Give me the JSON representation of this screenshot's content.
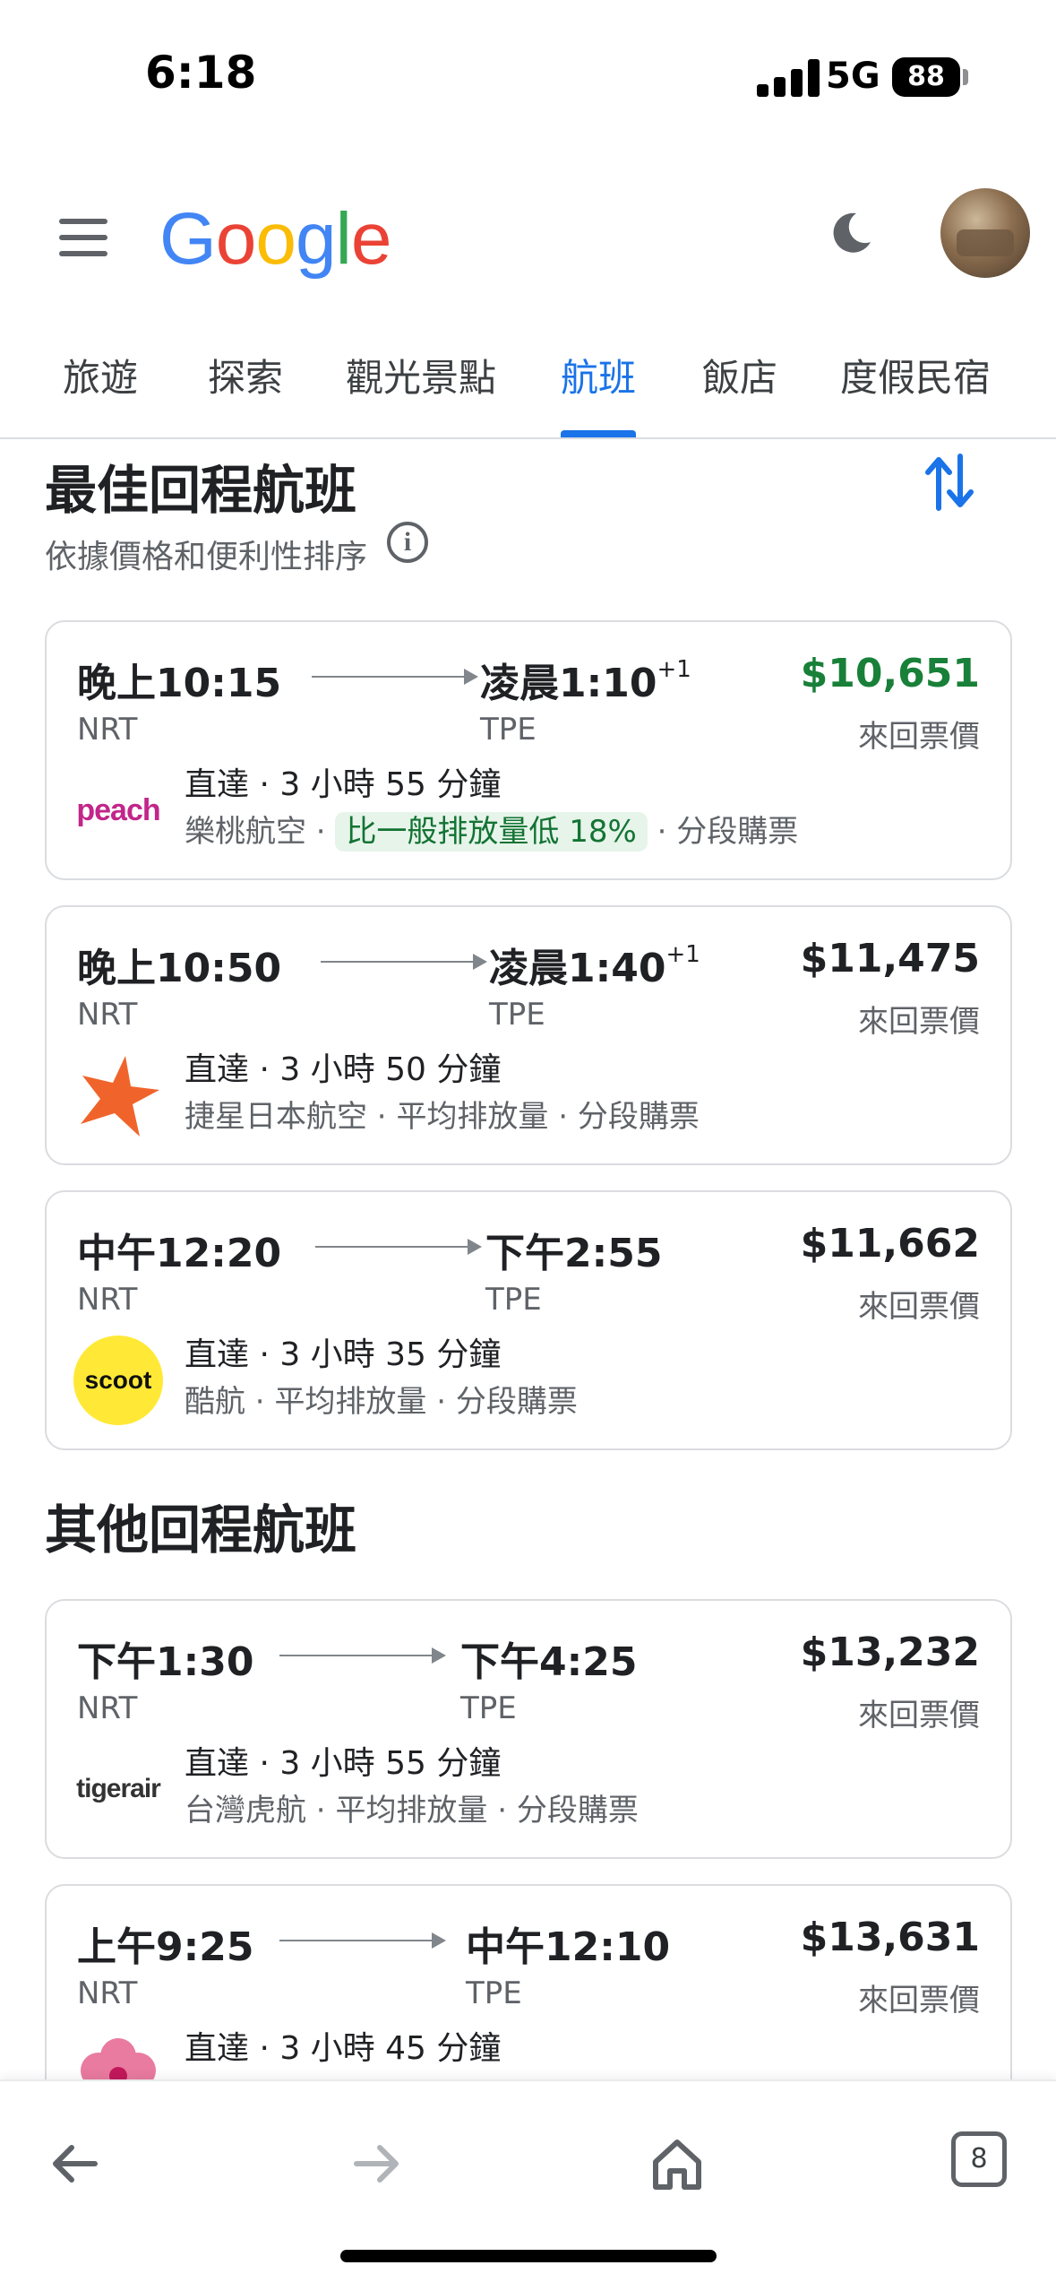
{
  "status_bar": {
    "time": "6:18",
    "network": "5G",
    "battery": "88"
  },
  "header": {
    "logo_letters": [
      {
        "ch": "G",
        "color": "#4285F4"
      },
      {
        "ch": "o",
        "color": "#EA4335"
      },
      {
        "ch": "o",
        "color": "#FBBC05"
      },
      {
        "ch": "g",
        "color": "#4285F4"
      },
      {
        "ch": "l",
        "color": "#34A853"
      },
      {
        "ch": "e",
        "color": "#EA4335"
      }
    ]
  },
  "tabs": [
    "旅遊",
    "探索",
    "觀光景點",
    "航班",
    "飯店",
    "度假民宿"
  ],
  "active_tab": "航班",
  "best": {
    "title": "最佳回程航班",
    "subtitle": "依據價格和便利性排序"
  },
  "other": {
    "title": "其他回程航班"
  },
  "flights": [
    {
      "dep_time": "晚上10:15",
      "arr_time": "凌晨1:10",
      "day_offset": "+1",
      "dep_code": "NRT",
      "arr_code": "TPE",
      "price": "$10,651",
      "price_label": "來回票價",
      "duration": "直達 · 3 小時 55 分鐘",
      "airline": "樂桃航空",
      "emission": "比一般排放量低 18%",
      "booking": "分段購票",
      "logo": "peach",
      "logo_text": "peach"
    },
    {
      "dep_time": "晚上10:50",
      "arr_time": "凌晨1:40",
      "day_offset": "+1",
      "dep_code": "NRT",
      "arr_code": "TPE",
      "price": "$11,475",
      "price_label": "來回票價",
      "duration": "直達 · 3 小時 50 分鐘",
      "airline": "捷星日本航空",
      "emission": "平均排放量",
      "booking": "分段購票",
      "logo": "jetstar"
    },
    {
      "dep_time": "中午12:20",
      "arr_time": "下午2:55",
      "day_offset": "",
      "dep_code": "NRT",
      "arr_code": "TPE",
      "price": "$11,662",
      "price_label": "來回票價",
      "duration": "直達 · 3 小時 35 分鐘",
      "airline": "酷航",
      "emission": "平均排放量",
      "booking": "分段購票",
      "logo": "scoot",
      "logo_text": "scoot"
    },
    {
      "dep_time": "下午1:30",
      "arr_time": "下午4:25",
      "day_offset": "",
      "dep_code": "NRT",
      "arr_code": "TPE",
      "price": "$13,232",
      "price_label": "來回票價",
      "duration": "直達 · 3 小時 55 分鐘",
      "airline": "台灣虎航",
      "emission": "平均排放量",
      "booking": "分段購票",
      "logo": "tigerair",
      "logo_text": "tigerair"
    },
    {
      "dep_time": "上午9:25",
      "arr_time": "中午12:10",
      "day_offset": "",
      "dep_code": "NRT",
      "arr_code": "TPE",
      "price": "$13,631",
      "price_label": "來回票價",
      "duration": "直達 · 3 小時 45 分鐘",
      "logo": "china-airlines"
    }
  ],
  "bottom_bar": {
    "tab_count": "8"
  }
}
